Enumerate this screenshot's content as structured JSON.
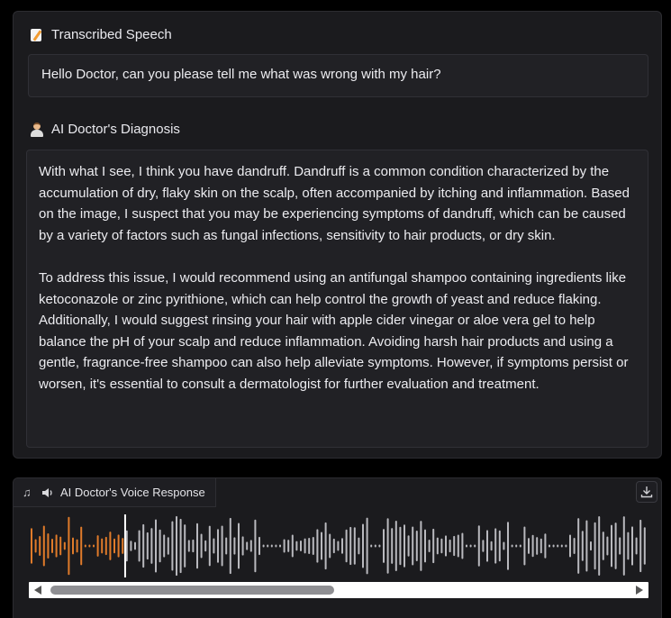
{
  "transcription": {
    "label": "Transcribed Speech",
    "icon": "memo-icon",
    "text": "Hello Doctor, can you please tell me what was wrong with my hair?"
  },
  "diagnosis": {
    "label": "AI Doctor's Diagnosis",
    "icon": "doctor-icon",
    "paragraphs": [
      "With what I see, I think you have dandruff. Dandruff is a common condition characterized by the accumulation of dry, flaky skin on the scalp, often accompanied by itching and inflammation. Based on the image, I suspect that you may be experiencing symptoms of dandruff, which can be caused by a variety of factors such as fungal infections, sensitivity to hair products, or dry skin.",
      "To address this issue, I would recommend using an antifungal shampoo containing ingredients like ketoconazole or zinc pyrithione, which can help control the growth of yeast and reduce flaking. Additionally, I would suggest rinsing your hair with apple cider vinegar or aloe vera gel to help balance the pH of your scalp and reduce inflammation. Avoiding harsh hair products and using a gentle, fragrance-free shampoo can also help alleviate symptoms. However, if symptoms persist or worsen, it's essential to consult a dermatologist for further evaluation and treatment."
    ]
  },
  "audio": {
    "label": "AI Doctor's Voice Response",
    "icons": [
      "music-icon",
      "speaker-icon",
      "download-icon"
    ],
    "played_fraction": 0.155,
    "colors": {
      "played": "#e07b2a",
      "unplayed": "#b9b9be",
      "cursor": "#ffffff"
    }
  }
}
